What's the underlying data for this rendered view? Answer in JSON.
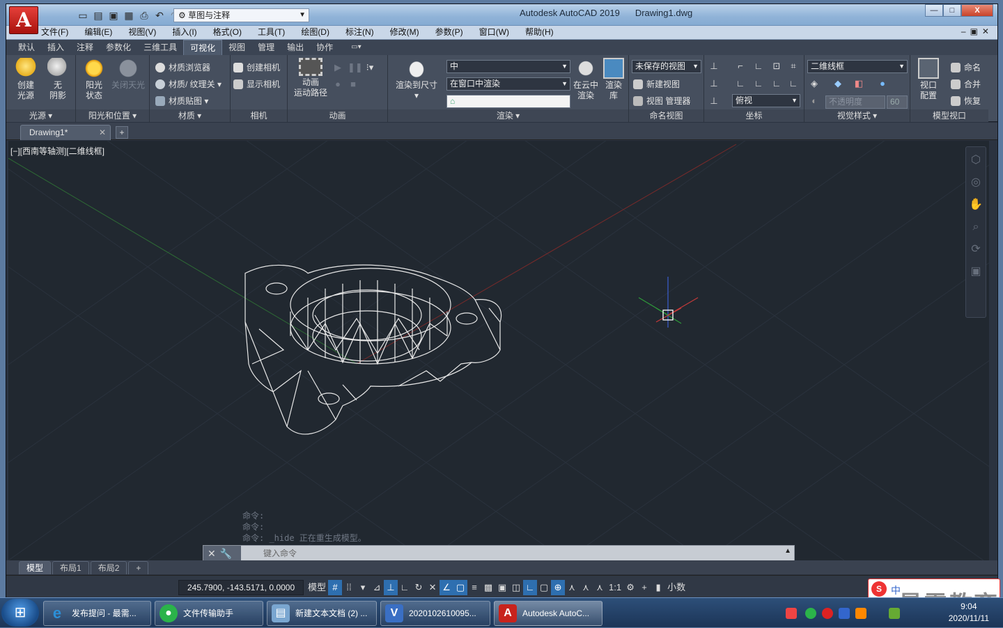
{
  "title": {
    "app": "Autodesk AutoCAD 2019",
    "file": "Drawing1.dwg",
    "app_letter": "A"
  },
  "workspace": "草图与注释",
  "window_controls": {
    "min": "—",
    "max": "□",
    "close": "X"
  },
  "menu": [
    "文件(F)",
    "编辑(E)",
    "视图(V)",
    "插入(I)",
    "格式(O)",
    "工具(T)",
    "绘图(D)",
    "标注(N)",
    "修改(M)",
    "参数(P)",
    "窗口(W)",
    "帮助(H)"
  ],
  "ribbon_tabs": [
    "默认",
    "插入",
    "注释",
    "参数化",
    "三维工具",
    "可视化",
    "视图",
    "管理",
    "输出",
    "协作"
  ],
  "active_tab": "可视化",
  "panels": {
    "lights": {
      "title": "光源",
      "create_light": [
        "创建",
        "光源"
      ],
      "no_shadow": [
        "无",
        "阴影"
      ]
    },
    "sun": {
      "title": "阳光和位置",
      "sun_status": [
        "阳光",
        "状态"
      ],
      "sky_off": "关闭天光"
    },
    "materials": {
      "title": "材质",
      "browser": "材质浏览器",
      "mat_tex": "材质/ 纹理关",
      "mapping": "材质贴图"
    },
    "camera": {
      "title": "相机",
      "create": "创建相机",
      "show": "显示相机"
    },
    "animation": {
      "title": "动画",
      "motion_path": [
        "动画",
        "运动路径"
      ]
    },
    "render": {
      "title": "渲染",
      "render_to_size": "渲染到尺寸",
      "quality": "中",
      "render_in": "在窗口中渲染",
      "cloud": [
        "在云中",
        "渲染"
      ],
      "gallery": [
        "渲染",
        "库"
      ]
    },
    "named_views": {
      "title": "命名视图",
      "unsaved": "未保存的视图",
      "new_view": "新建视图",
      "view_manager": "视图 管理器"
    },
    "coordinates": {
      "title": "坐标",
      "top_view": "俯视"
    },
    "visual_styles": {
      "title": "视觉样式",
      "style": "二维线框",
      "opacity_label": "不透明度",
      "opacity_value": "60"
    },
    "model_viewports": {
      "title": "模型视口",
      "config": [
        "视口",
        "配置"
      ],
      "name": "命名",
      "merge": "合并",
      "restore": "恢复"
    }
  },
  "doc_tab": "Drawing1*",
  "viewport_label": "[−][西南等轴测][二维线框]",
  "command_history": [
    "命令:",
    "命令:",
    "命令: _hide 正在重生成模型。"
  ],
  "command_placeholder": "键入命令",
  "layout_tabs": [
    "模型",
    "布局1",
    "布局2",
    "+"
  ],
  "status": {
    "coords": "245.7900, -143.5171, 0.0000",
    "model": "模型",
    "scale": "1:1",
    "units": "小数"
  },
  "taskbar": [
    {
      "label": "发布提问 - 最需...",
      "icon": "ie-icon",
      "color": "#2b8fd8"
    },
    {
      "label": "文件传输助手",
      "icon": "wechat-icon",
      "color": "#2bb34a"
    },
    {
      "label": "新建文本文档 (2) ...",
      "icon": "notepad-icon",
      "color": "#7aa6d0"
    },
    {
      "label": "2020102610095...",
      "icon": "visio-icon",
      "color": "#3a6fc4"
    },
    {
      "label": "Autodesk AutoC...",
      "icon": "autocad-icon",
      "color": "#c8231c"
    }
  ],
  "clock": {
    "time": "9:04",
    "date": "2020/11/11"
  },
  "watermark": "最需教育",
  "sogou_label": "中"
}
